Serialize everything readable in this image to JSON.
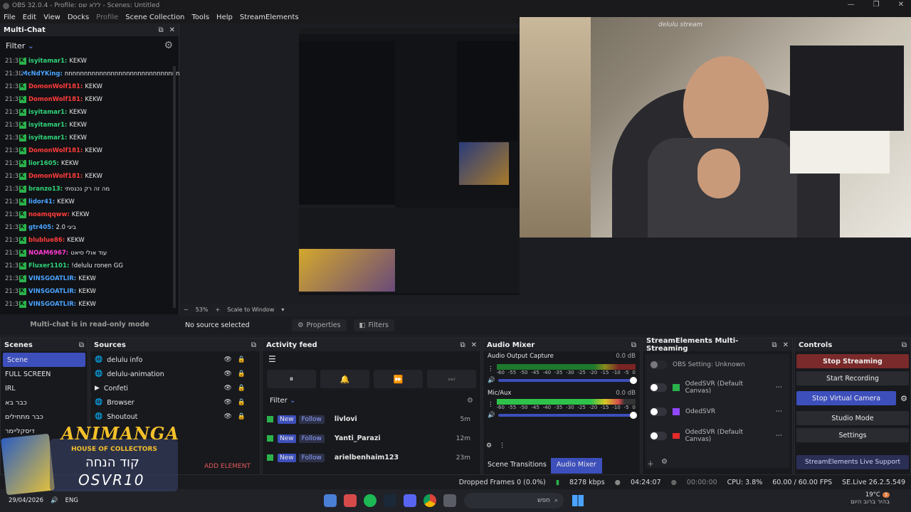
{
  "title": "OBS 32.0.4 - Profile: ללא שם - Scenes: Untitled",
  "menu": [
    "File",
    "Edit",
    "View",
    "Docks",
    "Profile",
    "Scene Collection",
    "Tools",
    "Help",
    "StreamElements"
  ],
  "multichat": {
    "title": "Multi-Chat",
    "filter": "Filter",
    "readonly": "Multi-chat is in read-only mode",
    "messages": [
      {
        "time": "21:38",
        "user": "isyitamar1:",
        "msg": "KEKW",
        "color": "#2fd47a"
      },
      {
        "time": "21:38",
        "user": "McNdYKing:",
        "msg": "nnnnnnnnnnnnnnnnnnnnnnnnnnnnnnnnn",
        "color": "#4aa3ff"
      },
      {
        "time": "21:38",
        "user": "DomonWolf181:",
        "msg": "KEKW",
        "color": "#ff3b3b"
      },
      {
        "time": "21:38",
        "user": "DomonWolf181:",
        "msg": "KEKW",
        "color": "#ff3b3b"
      },
      {
        "time": "21:38",
        "user": "isyitamar1:",
        "msg": "KEKW",
        "color": "#2fd47a"
      },
      {
        "time": "21:38",
        "user": "isyitamar1:",
        "msg": "KEKW",
        "color": "#2fd47a"
      },
      {
        "time": "21:38",
        "user": "isyitamar1:",
        "msg": "KEKW",
        "color": "#2fd47a"
      },
      {
        "time": "21:38",
        "user": "DomonWolf181:",
        "msg": "KEKW",
        "color": "#ff3b3b"
      },
      {
        "time": "21:38",
        "user": "lior1605:",
        "msg": "KEKW",
        "color": "#2fd47a"
      },
      {
        "time": "21:38",
        "user": "DomonWolf181:",
        "msg": "KEKW",
        "color": "#ff3b3b"
      },
      {
        "time": "21:38",
        "user": "branzo13:",
        "msg": "מה זה רק נכנסתי",
        "color": "#2fd47a"
      },
      {
        "time": "21:38",
        "user": "lidor41:",
        "msg": "KEKW",
        "color": "#4aa3ff"
      },
      {
        "time": "21:38",
        "user": "noamqqww:",
        "msg": "KEKW",
        "color": "#ff3b3b"
      },
      {
        "time": "21:38",
        "user": "gtr405:",
        "msg": "ביגי 2.0",
        "color": "#4aa3ff"
      },
      {
        "time": "21:38",
        "user": "blublue86:",
        "msg": "KEKW",
        "color": "#ff3b3b"
      },
      {
        "time": "21:38",
        "user": "NOAM6967:",
        "msg": "עוד אולי סיאט",
        "color": "#ff3bd4"
      },
      {
        "time": "21:38",
        "user": "Fluxer1101:",
        "msg": "!delulu ronen GG",
        "color": "#2fd47a"
      },
      {
        "time": "21:38",
        "user": "VINSGOATLIR:",
        "msg": "KEKW",
        "color": "#4aa3ff"
      },
      {
        "time": "21:38",
        "user": "VINSGOATLIR:",
        "msg": "KEKW",
        "color": "#4aa3ff"
      },
      {
        "time": "21:38",
        "user": "VINSGOATLIR:",
        "msg": "KEKW",
        "color": "#4aa3ff"
      }
    ]
  },
  "preview": {
    "watermark": "delulu stream",
    "zoom": "53%",
    "scale_mode": "Scale to Window",
    "no_source": "No source selected",
    "properties": "Properties",
    "filters": "Filters"
  },
  "scenes": {
    "title": "Scenes",
    "items": [
      "Scene",
      "FULL SCREEN",
      "IRL",
      "כבר בא",
      "כבר מתחילים",
      "דיסקליימר"
    ]
  },
  "sources": {
    "title": "Sources",
    "items": [
      "delulu info",
      "delulu-animation",
      "Confeti",
      "Browser",
      "Shoutout"
    ],
    "add": "ADD ELEMENT"
  },
  "activity": {
    "title": "Activity feed",
    "filter": "Filter",
    "rows": [
      {
        "new": "New",
        "follow": "Follow",
        "user": "livlovi",
        "time": "5m"
      },
      {
        "new": "New",
        "follow": "Follow",
        "user": "Yanti_Parazi",
        "time": "12m"
      },
      {
        "new": "New",
        "follow": "Follow",
        "user": "arielbenhaim123",
        "time": "23m"
      }
    ]
  },
  "mixer": {
    "title": "Audio Mixer",
    "channels": [
      {
        "name": "Audio Output Capture",
        "db": "0.0 dB"
      },
      {
        "name": "Mic/Aux",
        "db": "0.0 dB"
      }
    ],
    "scale": [
      "-60",
      "-55",
      "-50",
      "-45",
      "-40",
      "-35",
      "-30",
      "-25",
      "-20",
      "-15",
      "-10",
      "-5",
      "0"
    ],
    "tab_transitions": "Scene Transitions",
    "tab_mixer": "Audio Mixer"
  },
  "se": {
    "title": "StreamElements Multi-Streaming",
    "rows": [
      {
        "label": "OBS Setting: Unknown",
        "sub": ""
      },
      {
        "label": "OdedSVR (Default Canvas)",
        "sub": ""
      },
      {
        "label": "OdedSVR",
        "sub": ""
      },
      {
        "label": "OdedSVR (Default Canvas)",
        "sub": ""
      }
    ]
  },
  "controls": {
    "title": "Controls",
    "stop_streaming": "Stop Streaming",
    "start_recording": "Start Recording",
    "stop_vcam": "Stop Virtual Camera",
    "studio_mode": "Studio Mode",
    "settings": "Settings",
    "support": "StreamElements Live Support"
  },
  "status": {
    "dropped": "Dropped Frames 0 (0.0%)",
    "kbps": "8278 kbps",
    "live_time": "04:24:07",
    "rec_time": "00:00:00",
    "cpu": "CPU: 3.8%",
    "fps": "60.00 / 60.00 FPS",
    "version": "SE.Live 26.2.5.549"
  },
  "taskbar": {
    "date": "29/04/2026",
    "lang": "ENG",
    "search": "חפש",
    "temp": "19°C",
    "weather": "בהיר ברוב היום",
    "notif": "3"
  },
  "logo": {
    "line1": "ANIMANGA",
    "line2": "HOUSE OF COLLECTORS",
    "line3": "קוד הנחה",
    "line4": "OSVR10"
  },
  "colors": {
    "accent": "#3d4fbb",
    "stop": "#7a2a2a",
    "vcam": "#3d4fbb",
    "green": "#2bb24c"
  }
}
